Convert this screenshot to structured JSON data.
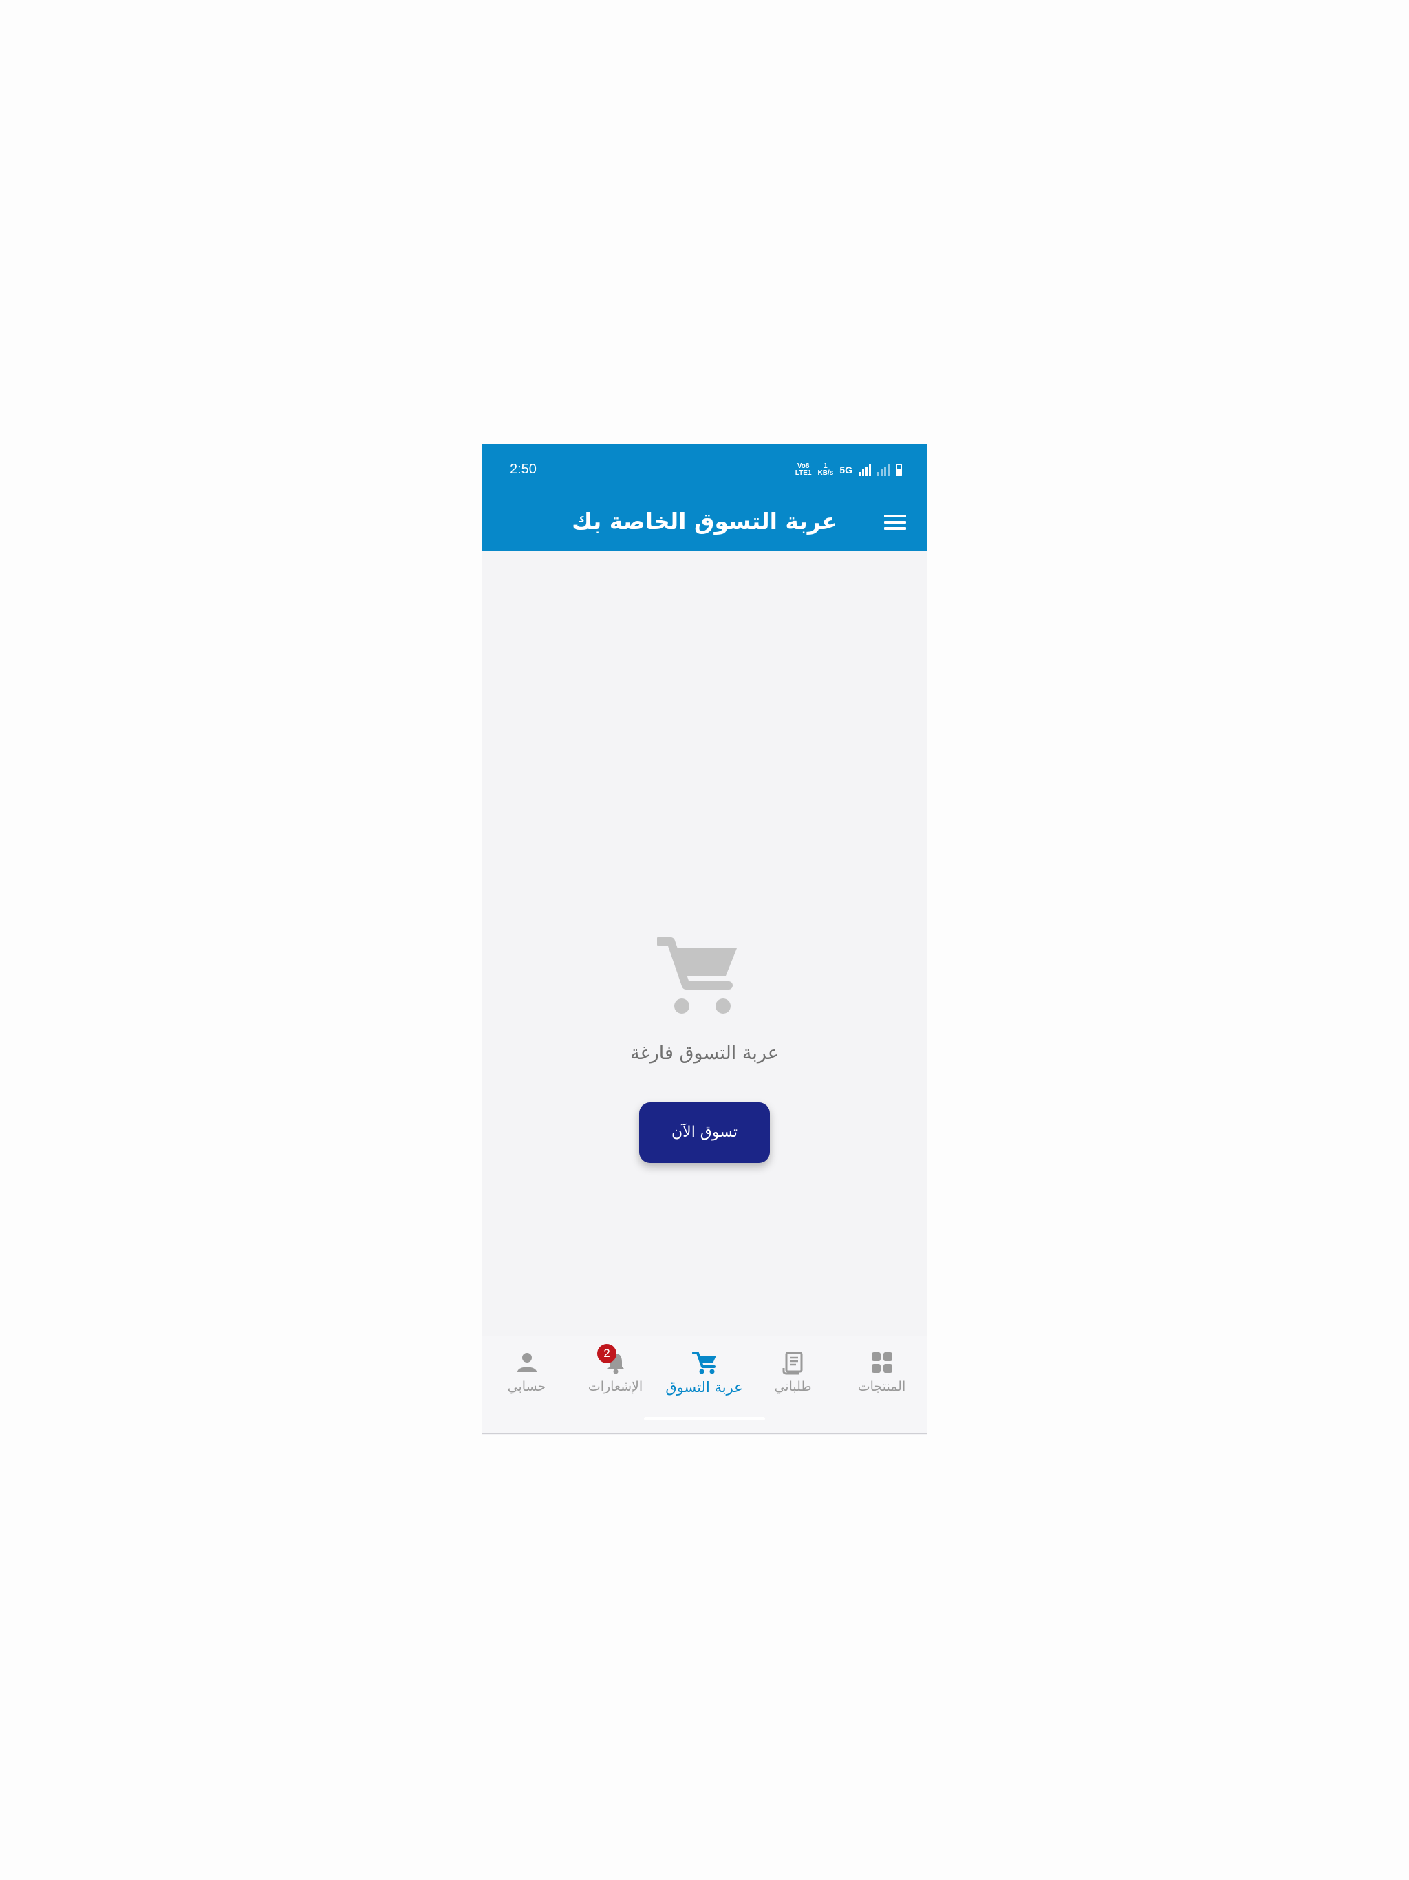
{
  "status_bar": {
    "time": "2:50",
    "volte": "Vo8\nLTE1",
    "data_rate": "1\nKB/s",
    "network": "5G"
  },
  "app_bar": {
    "title": "عربة التسوق الخاصة بك",
    "menu_icon": "hamburger-menu-icon"
  },
  "empty_state": {
    "icon": "shopping-cart-icon",
    "message": "عربة التسوق فارغة",
    "button_label": "تسوق الآن"
  },
  "bottom_nav": {
    "items": [
      {
        "label": "حسابي",
        "icon": "person-icon"
      },
      {
        "label": "الإشعارات",
        "icon": "bell-icon",
        "badge": "2"
      },
      {
        "label": "عربة التسوق",
        "icon": "shopping-cart-icon",
        "active": true
      },
      {
        "label": "طلباتي",
        "icon": "receipt-icon"
      },
      {
        "label": "المنتجات",
        "icon": "grid-icon"
      }
    ]
  },
  "colors": {
    "primary": "#0788c9",
    "button": "#1b2587",
    "badge": "#c0161d",
    "inactive": "#9a9a9a",
    "background": "#f4f4f6"
  }
}
